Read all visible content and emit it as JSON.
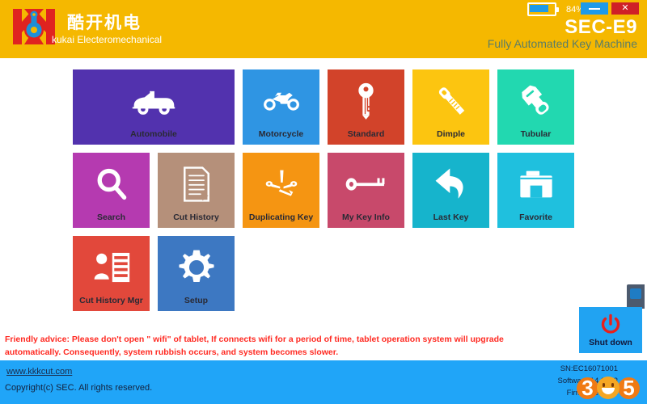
{
  "header": {
    "brand_cn": "酷开机电",
    "brand_en": "kukai Electeromechanical",
    "model": "SEC-E9",
    "tagline": "Fully Automated Key Machine",
    "battery_percent": "84%",
    "minimize_icon": "minimize-icon",
    "close_icon": "close-icon",
    "close_glyph": "✕",
    "logo_icon": "kukai-logo-icon"
  },
  "tiles": {
    "rows": [
      [
        {
          "label": "Automobile",
          "color": "#5232ae",
          "icon": "car-icon",
          "wide": true
        },
        {
          "label": "Motorcycle",
          "color": "#2f95e3",
          "icon": "motorcycle-icon",
          "wide": false
        },
        {
          "label": "Standard",
          "color": "#d2432a",
          "icon": "standard-key-icon",
          "wide": false
        },
        {
          "label": "Dimple",
          "color": "#fcc510",
          "icon": "dimple-key-icon",
          "wide": false
        },
        {
          "label": "Tubular",
          "color": "#22d8b0",
          "icon": "tubular-key-icon",
          "wide": false
        }
      ],
      [
        {
          "label": "Search",
          "color": "#b53ab0",
          "icon": "search-icon",
          "wide": false
        },
        {
          "label": "Cut History",
          "color": "#b5907a",
          "icon": "document-icon",
          "wide": false
        },
        {
          "label": "Duplicating Key",
          "color": "#f59512",
          "icon": "duplicate-key-icon",
          "wide": false
        },
        {
          "label": "My Key Info",
          "color": "#c8496b",
          "icon": "old-key-icon",
          "wide": false
        },
        {
          "label": "Last Key",
          "color": "#16b4cc",
          "icon": "undo-arrow-icon",
          "wide": false
        },
        {
          "label": "Favorite",
          "color": "#1fc0de",
          "icon": "folder-icon",
          "wide": false
        }
      ],
      [
        {
          "label": "Cut History Mgr",
          "color": "#e2483b",
          "icon": "user-records-icon",
          "wide": false
        },
        {
          "label": "Setup",
          "color": "#3d78c2",
          "icon": "gear-icon",
          "wide": false
        }
      ]
    ]
  },
  "shutdown": {
    "label": "Shut down",
    "icon": "power-icon"
  },
  "side_badge": {
    "icon": "device-badge-icon"
  },
  "advice": {
    "text": "Friendly advice: Please don't open \" wifi\" of tablet, If connects wifi for a period of time, tablet operation system will upgrade automatically. Consequently, system rubbish occurs, and system becomes slower."
  },
  "footer": {
    "url": "www.kkkcut.com",
    "copyright": "Copyright(c) SEC.  All rights reserved.",
    "serial_number": "SN:EC16071001",
    "software_version": "Software:14.0.0.3",
    "firmware_version": "Firmware:1.0.3"
  },
  "watermark": {
    "digit_left": "3",
    "digit_right": "5",
    "face_icon": "smiley-face-icon"
  },
  "colors": {
    "header_bg": "#f5b800",
    "footer_bg": "#20a5f8",
    "accent_blue": "#1e9ae8",
    "close_red": "#cf2027",
    "advice_red": "#ff2a22"
  }
}
